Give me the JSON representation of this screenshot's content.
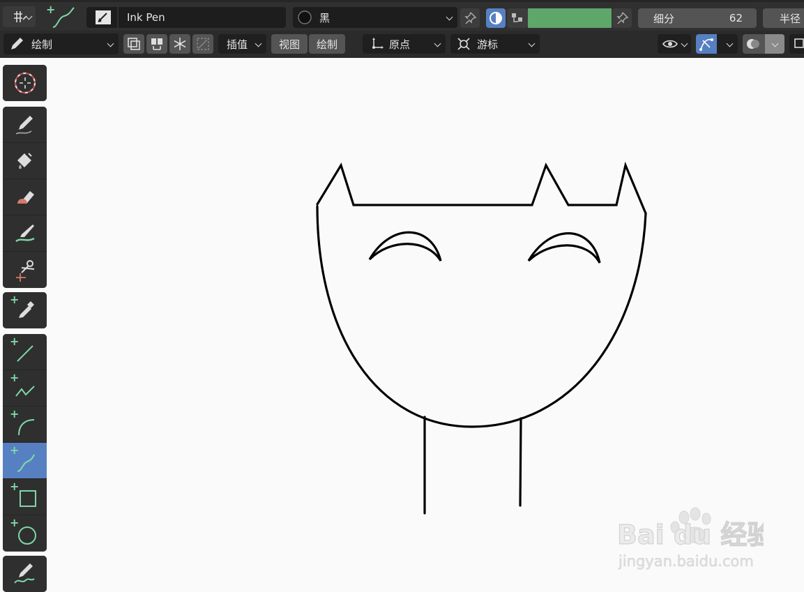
{
  "header": {
    "brush_name": "Ink Pen",
    "material_name": "黑",
    "strength_label": "细分",
    "strength_value": "62",
    "radius_label": "半径"
  },
  "toolbar2": {
    "mode_label": "绘制",
    "interpolate_label": "插值",
    "view_label": "视图",
    "draw_label": "绘制",
    "origin_label": "原点",
    "cursor_label": "游标"
  },
  "colors": {
    "accent": "#5680c2",
    "panel": "#303030",
    "field": "#1d1d1d",
    "strength_fill": "#5ea66a",
    "canvas": "#fafafa",
    "stroke": "#000000",
    "plus": "#7fd7a8"
  },
  "icons": {
    "tools": [
      "cursor-icon",
      "draw-icon",
      "fill-icon",
      "erase-icon",
      "tint-icon",
      "cutter-icon",
      "eyedropper-icon",
      "line-icon",
      "polyline-icon",
      "arc-icon",
      "curve-icon",
      "box-icon",
      "circle-icon",
      "annotate-icon"
    ]
  },
  "watermark": {
    "brand": "Bai du 经验",
    "url": "jingyan.baidu.com"
  }
}
